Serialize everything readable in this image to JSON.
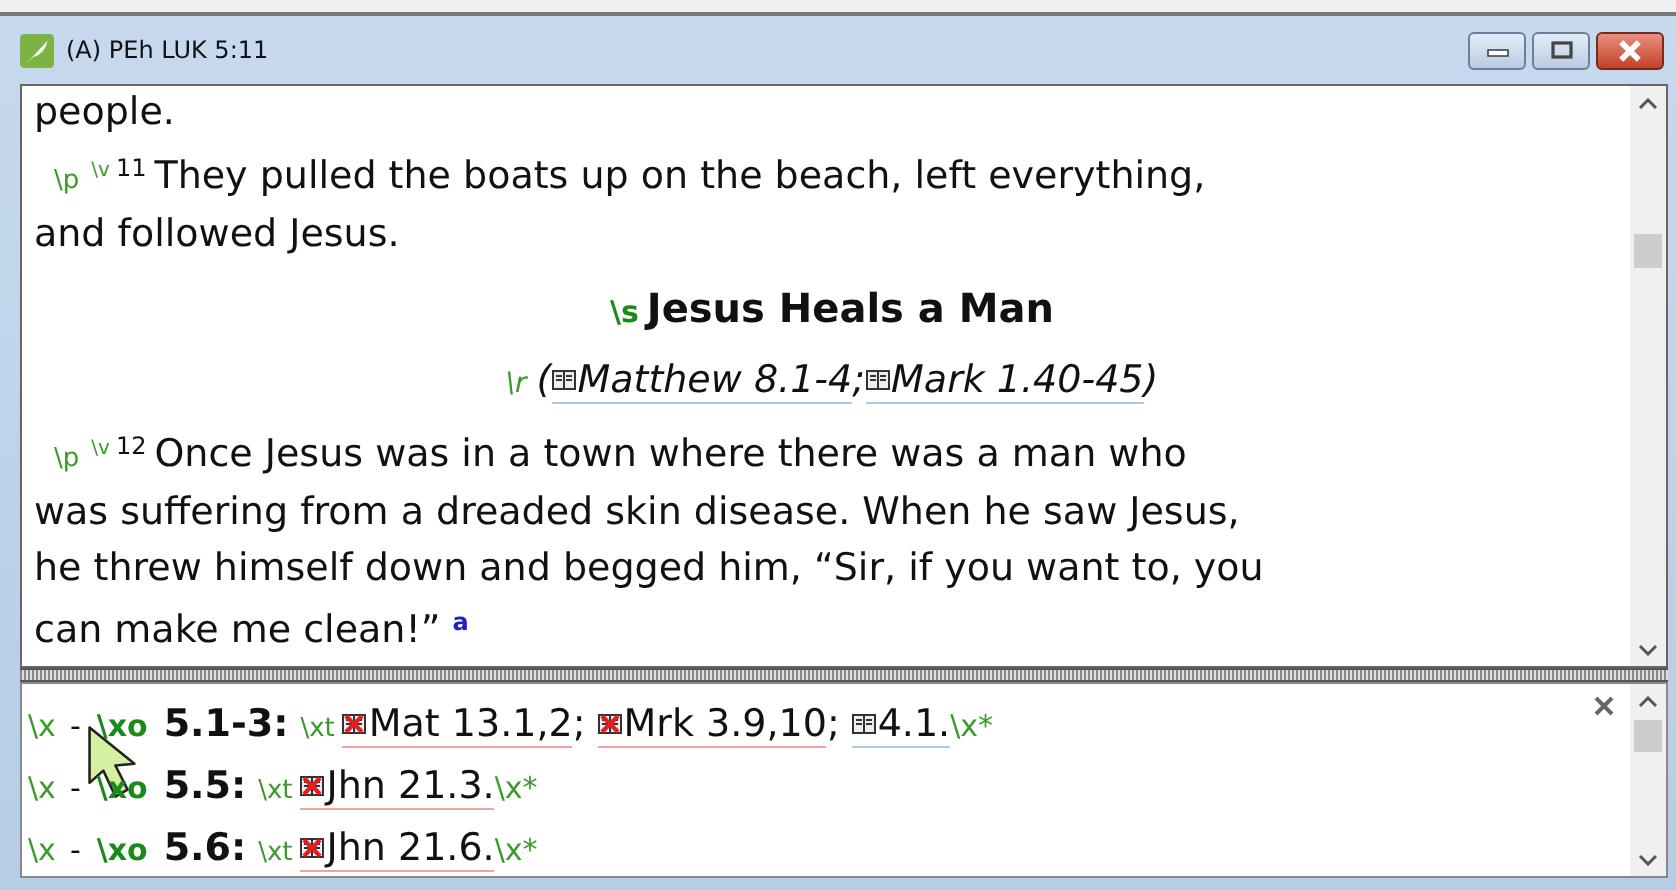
{
  "window": {
    "title": "(A) PEh LUK 5:11"
  },
  "editor": {
    "blocks": [
      {
        "kind": "plain",
        "lines": [
          "people."
        ]
      },
      {
        "kind": "paragraph",
        "marker": "\\p",
        "verse_marker": "\\v",
        "verse": "11",
        "lines": [
          "They pulled the boats up on the beach, left everything,",
          "and followed Jesus."
        ]
      },
      {
        "kind": "heading",
        "marker": "\\s",
        "lines": [
          "Jesus Heals a Man"
        ]
      },
      {
        "kind": "reference",
        "marker": "\\r",
        "before": "(",
        "refs": [
          {
            "text": "Matthew 8.1-4",
            "after": ";",
            "broken": false
          },
          {
            "text": "Mark 1.40-45",
            "after": ")",
            "broken": false
          }
        ]
      },
      {
        "kind": "paragraph",
        "marker": "\\p",
        "verse_marker": "\\v",
        "verse": "12",
        "lines": [
          "Once Jesus was in a town where there was a man who",
          "was suffering from a dreaded skin disease. When he saw Jesus,",
          "he threw himself down and begged him, “Sir, if you want to, you",
          "can make me clean!”"
        ],
        "footnote": "a"
      }
    ]
  },
  "notes": {
    "rows": [
      {
        "marker": "\\x",
        "dash": "-",
        "origin_marker": "\\xo",
        "origin": "5.1-3:",
        "target_marker": "\\xt",
        "refs": [
          {
            "text": "Mat 13.1,2",
            "after": ";",
            "broken": true
          },
          {
            "text": "Mrk 3.9,10",
            "after": ";",
            "broken": true
          },
          {
            "text": "4.1.",
            "broken": false
          }
        ],
        "end_marker": "\\x*"
      },
      {
        "marker": "\\x",
        "dash": "-",
        "origin_marker": "\\xo",
        "origin": "5.5:",
        "target_marker": "\\xt",
        "refs": [
          {
            "text": "Jhn 21.3.",
            "broken": true
          }
        ],
        "end_marker": "\\x*"
      },
      {
        "marker": "\\x",
        "dash": "-",
        "origin_marker": "\\xo",
        "origin": "5.6:",
        "target_marker": "\\xt",
        "refs": [
          {
            "text": "Jhn 21.6.",
            "broken": true
          }
        ],
        "end_marker": "\\x*"
      }
    ]
  }
}
